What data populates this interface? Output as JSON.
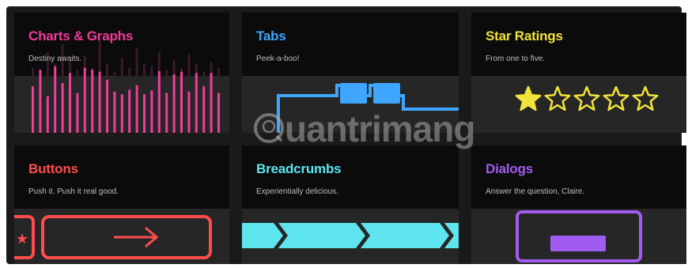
{
  "colors": {
    "background": "#1a1a1a",
    "card_header": "#0b0b0b",
    "card_body": "#262626",
    "charts": "#f03c9b",
    "tabs": "#3ea6ff",
    "stars": "#f2e43a",
    "buttons": "#ff4d4d",
    "breadcrumbs": "#5ee4ee",
    "dialogs": "#a05cf0"
  },
  "cards": [
    {
      "id": "charts",
      "title": "Charts & Graphs",
      "subtitle": "Destiny awaits."
    },
    {
      "id": "tabs",
      "title": "Tabs",
      "subtitle": "Peek-a-boo!"
    },
    {
      "id": "stars",
      "title": "Star Ratings",
      "subtitle": "From one to five."
    },
    {
      "id": "buttons",
      "title": "Buttons",
      "subtitle": "Push it. Push it real good."
    },
    {
      "id": "breadcrumbs",
      "title": "Breadcrumbs",
      "subtitle": "Experientially delicious."
    },
    {
      "id": "dialogs",
      "title": "Dialogs",
      "subtitle": "Answer the question, Claire."
    }
  ],
  "chart_preview": {
    "bar_heights": [
      0.7,
      0.95,
      0.55,
      1.0,
      0.75,
      0.9,
      0.6,
      0.98,
      0.95,
      0.92,
      0.8,
      0.62,
      0.58,
      0.65,
      0.72,
      0.58,
      0.64,
      0.93,
      0.6,
      0.88,
      0.92,
      0.62,
      0.9,
      0.7,
      0.9,
      0.6
    ],
    "faint_bar_heights": [
      0.2,
      0.1,
      0.6,
      0.3,
      0.8,
      0.4,
      0.15,
      0.5,
      0.2,
      0.9,
      0.3,
      0.1,
      0.45,
      0.2,
      0.7,
      0.3,
      0.25,
      0.6,
      0.15,
      0.4,
      0.2,
      0.55,
      0.3,
      0.1,
      0.35,
      0.2
    ]
  },
  "star_rating": {
    "value": 1,
    "max": 5
  },
  "watermark": {
    "text": "uantrimang"
  }
}
